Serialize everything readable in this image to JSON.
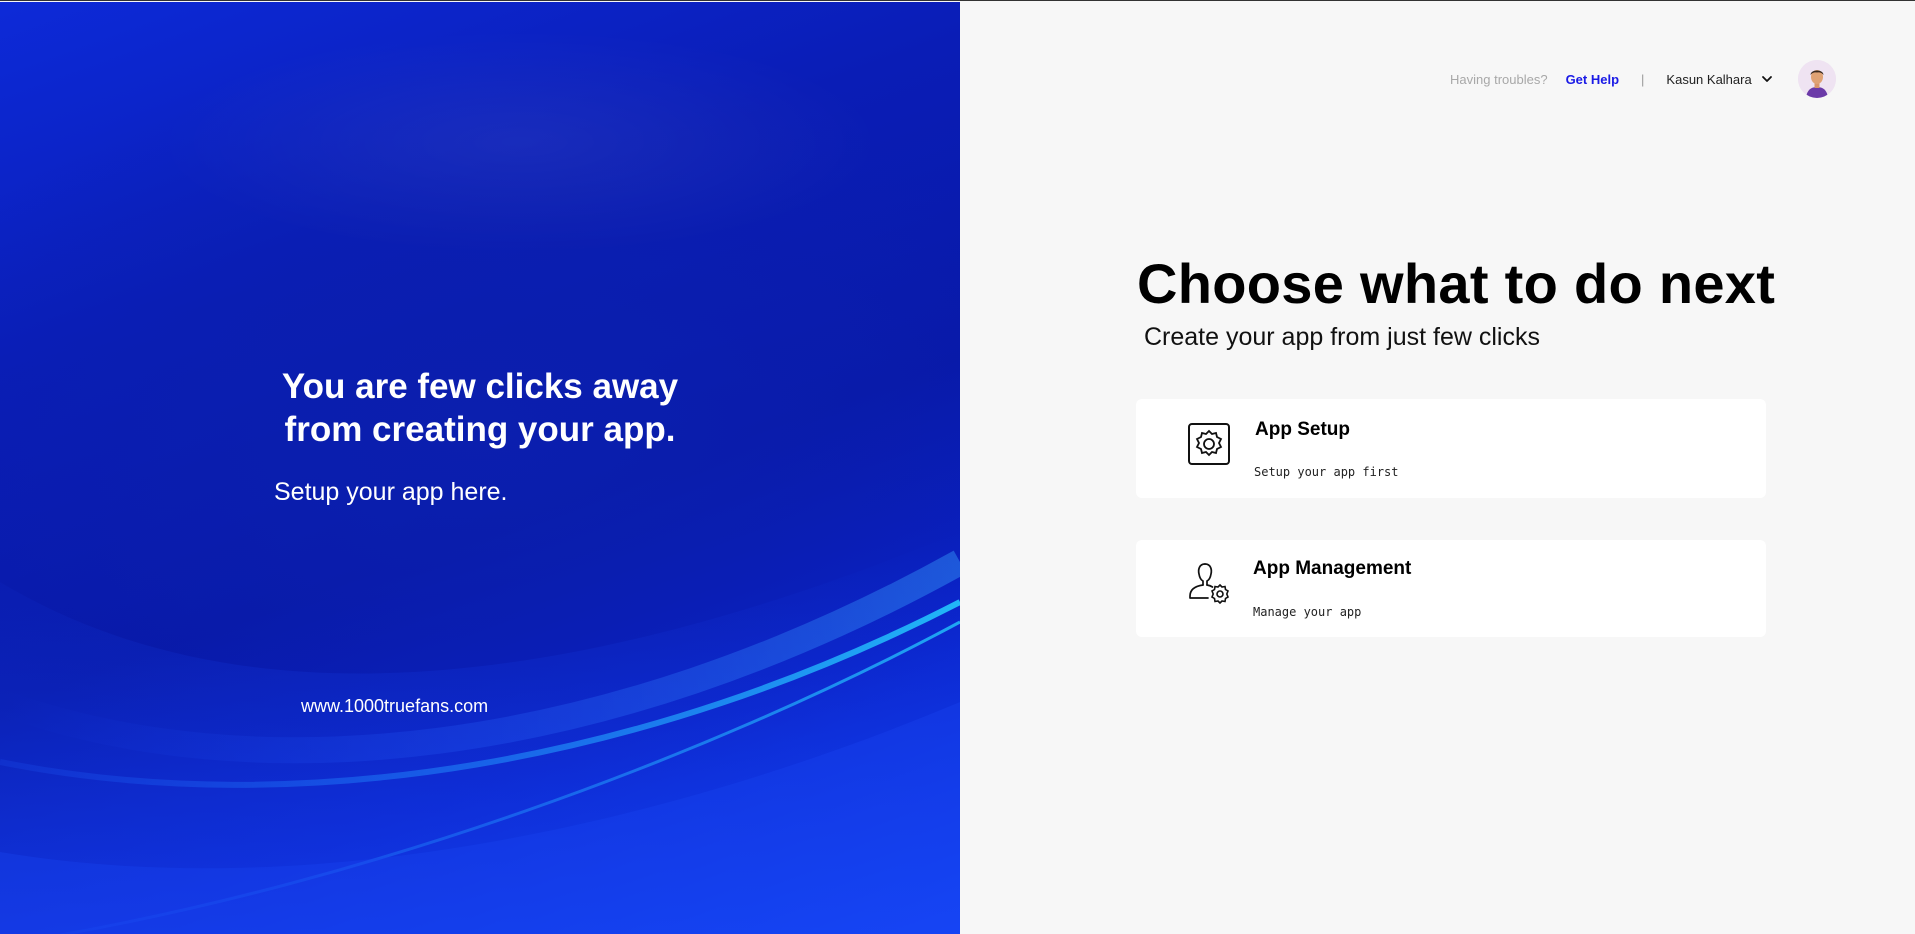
{
  "hero": {
    "title": "You are few clicks away from creating your app.",
    "subtitle": "Setup your app here.",
    "website": "www.1000truefans.com"
  },
  "topbar": {
    "help_prompt": "Having troubles?",
    "help_link": "Get Help",
    "divider": "|",
    "user_name": "Kasun Kalhara",
    "avatar_icon": "user-avatar-icon"
  },
  "main": {
    "title": "Choose what to do next",
    "subtitle": "Create your app from just few clicks",
    "options": [
      {
        "title": "App Setup",
        "description": "Setup your app first",
        "icon": "gear-settings-icon"
      },
      {
        "title": "App Management",
        "description": "Manage your app",
        "icon": "user-gear-icon"
      }
    ]
  },
  "colors": {
    "hero_blue": "#0a1db6",
    "link_blue": "#1a1ae6",
    "page_bg": "#f7f7f7",
    "card_bg": "#ffffff"
  }
}
